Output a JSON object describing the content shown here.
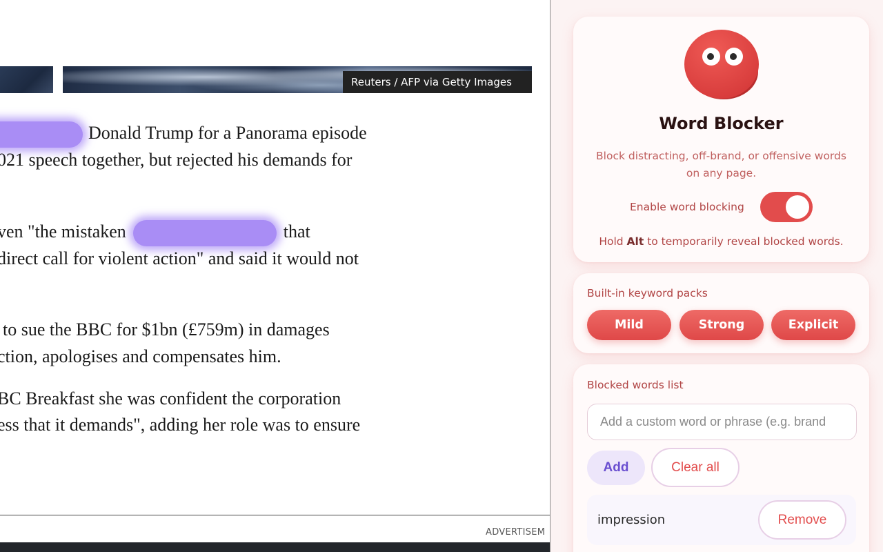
{
  "article": {
    "photo_credit": "Reuters / AFP via Getty Images",
    "paragraphs": [
      {
        "lines": [
          {
            "before": "",
            "after": "Donald Trump for a Panorama episode"
          },
          {
            "text": "021 speech together, but rejected his demands for"
          }
        ]
      },
      {
        "lines": [
          {
            "before": "ven \"the mistaken",
            "after": "that"
          },
          {
            "text": "direct call for violent action\" and said it would not"
          }
        ]
      },
      {
        "lines": [
          {
            "text": "to sue the BBC for $1bn (£759m) in damages"
          },
          {
            "text": "ction, apologises and compensates him."
          }
        ]
      },
      {
        "lines": [
          {
            "text": "BC Breakfast she was confident the corporation"
          },
          {
            "text": "ess that it demands\", adding her role was to ensure"
          }
        ]
      }
    ],
    "ad_label": "ADVERTISEM"
  },
  "extension": {
    "title": "Word Blocker",
    "subtitle": "Block distracting, off-brand, or offensive words on any page.",
    "toggle": {
      "label": "Enable word blocking",
      "enabled": true
    },
    "hint": {
      "prefix": "Hold ",
      "key": "Alt",
      "suffix": " to temporarily reveal blocked words."
    },
    "packs": {
      "label": "Built-in keyword packs",
      "items": [
        "Mild",
        "Strong",
        "Explicit"
      ]
    },
    "list": {
      "label": "Blocked words list",
      "input_placeholder": "Add a custom word or phrase (e.g. brand",
      "input_value": "",
      "add_label": "Add",
      "clear_label": "Clear all",
      "words": [
        {
          "word": "impression",
          "remove_label": "Remove"
        }
      ]
    },
    "colors": {
      "accent": "#e24c4c",
      "text": "#b14545",
      "title": "#2a1212"
    }
  }
}
